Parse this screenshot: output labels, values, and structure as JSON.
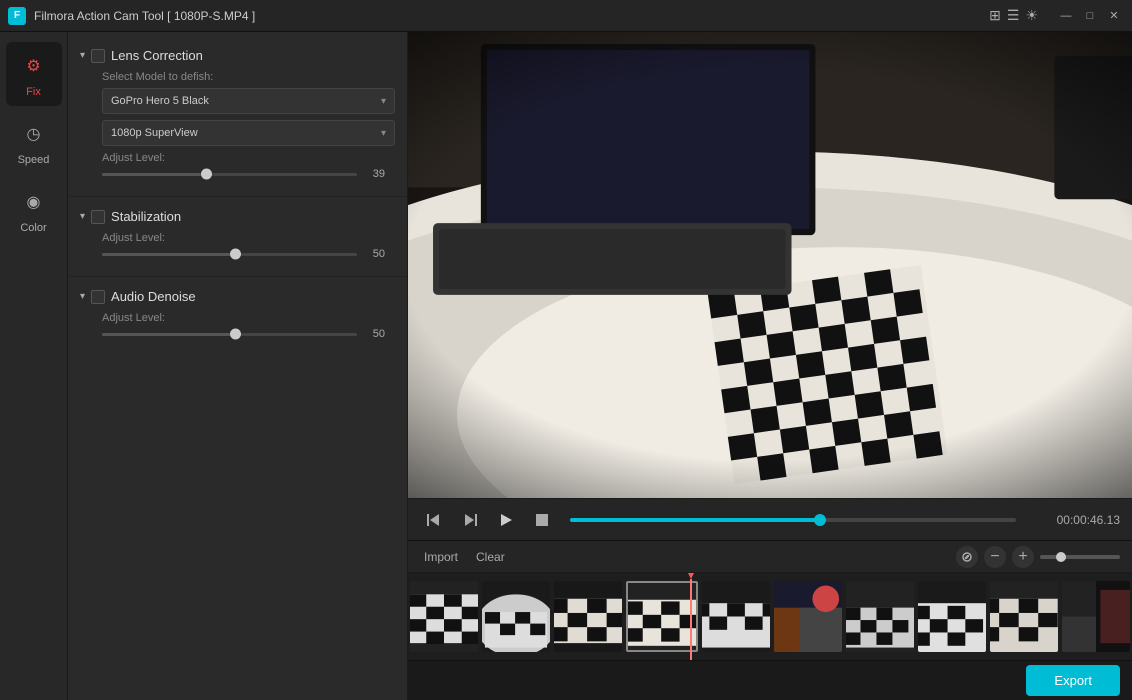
{
  "titlebar": {
    "app_icon": "F",
    "title": "Filmora Action Cam Tool  [ 1080P-S.MP4 ]",
    "minimize_label": "—",
    "maximize_label": "□",
    "close_label": "✕"
  },
  "sidebar": {
    "items": [
      {
        "id": "fix",
        "label": "Fix",
        "icon": "⚙",
        "active": true
      },
      {
        "id": "speed",
        "label": "Speed",
        "icon": "◷",
        "active": false
      },
      {
        "id": "color",
        "label": "Color",
        "icon": "◉",
        "active": false
      }
    ]
  },
  "panel": {
    "sections": [
      {
        "id": "lens-correction",
        "title": "Lens Correction",
        "expanded": true,
        "enabled": false,
        "subsections": [
          {
            "id": "model-select",
            "label": "Select Model to defish:",
            "dropdown1": {
              "value": "GoPro Hero 5 Black"
            },
            "dropdown2": {
              "value": "1080p SuperView"
            },
            "slider": {
              "label": "Adjust Level:",
              "value": 39,
              "percent": 39
            }
          }
        ]
      },
      {
        "id": "stabilization",
        "title": "Stabilization",
        "expanded": true,
        "enabled": false,
        "subsections": [
          {
            "id": "stab-slider",
            "slider": {
              "label": "Adjust Level:",
              "value": 50,
              "percent": 50
            }
          }
        ]
      },
      {
        "id": "audio-denoise",
        "title": "Audio Denoise",
        "expanded": true,
        "enabled": false,
        "subsections": [
          {
            "id": "audio-slider",
            "slider": {
              "label": "Adjust Level:",
              "value": 50,
              "percent": 50
            }
          }
        ]
      }
    ]
  },
  "video_controls": {
    "skip_back_label": "⏮",
    "step_back_label": "⏭",
    "play_label": "▶",
    "stop_label": "◼",
    "progress_percent": 56,
    "time_display": "00:00:46.13"
  },
  "timeline": {
    "import_label": "Import",
    "clear_label": "Clear",
    "zoom_in_label": "+",
    "zoom_out_label": "−",
    "playhead_percent": 39
  },
  "export": {
    "button_label": "Export"
  },
  "icons": {
    "chevron_down": "▾",
    "chevron_right": "▸",
    "chain_icon": "⛓",
    "minus_circle": "⊖",
    "plus_circle": "⊕"
  }
}
